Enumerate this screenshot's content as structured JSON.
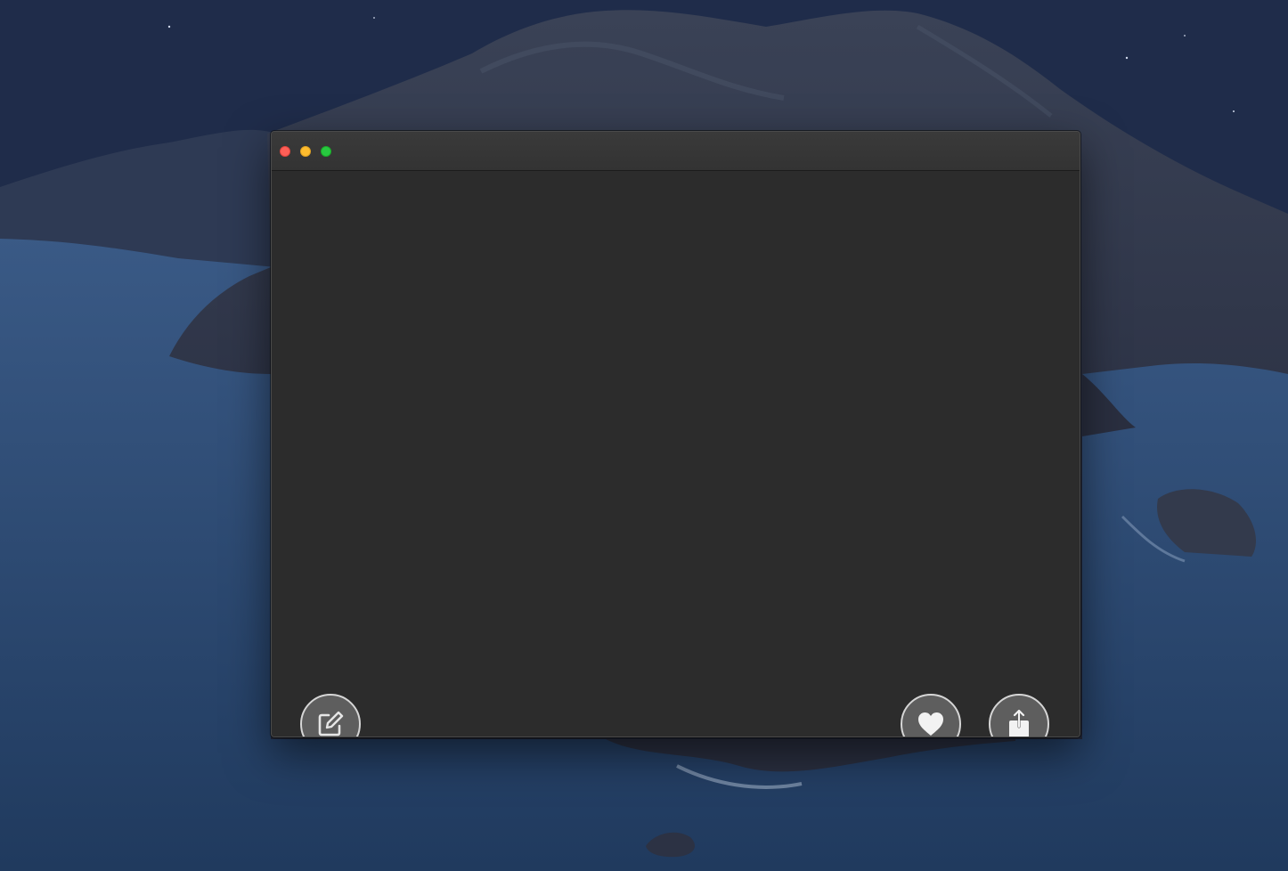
{
  "desktop": {
    "wallpaper": "catalina-island-night",
    "colors": {
      "sky": "#1a2744",
      "sea": "#2c4a72",
      "land": "#2b2e3f"
    }
  },
  "window": {
    "background": "#2c2c2c",
    "titlebar": {
      "buttons": {
        "close_color": "#fe5f57",
        "minimize_color": "#febc2e",
        "zoom_color": "#28c840"
      }
    },
    "actions": {
      "edit_icon": "compose-icon",
      "like_icon": "heart-icon",
      "share_icon": "share-icon"
    }
  }
}
